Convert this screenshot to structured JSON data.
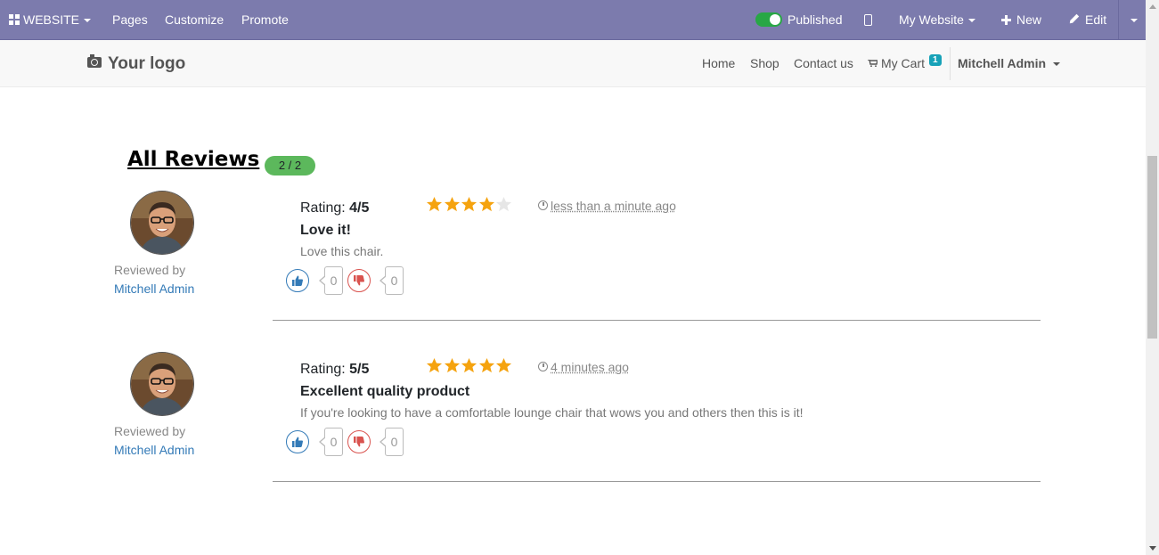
{
  "admin_bar": {
    "website_label": "WEBSITE",
    "pages_label": "Pages",
    "customize_label": "Customize",
    "promote_label": "Promote",
    "published_label": "Published",
    "published_on": true,
    "my_website_label": "My Website",
    "new_label": "New",
    "edit_label": "Edit",
    "bar_color": "#7c7bad"
  },
  "site_nav": {
    "logo_text": "Your logo",
    "links": [
      "Home",
      "Shop",
      "Contact us"
    ],
    "cart_label": "My Cart",
    "cart_count": "1",
    "user_name": "Mitchell Admin"
  },
  "reviews": {
    "title": "All Reviews",
    "count_badge": "2 / 2",
    "reviewed_by_label": "Reviewed by",
    "items": [
      {
        "rating_label": "Rating:",
        "rating_value": "4/5",
        "stars": 4,
        "time": "less than a minute ago",
        "title": "Love it!",
        "body": "Love this chair.",
        "reviewer": "Mitchell Admin",
        "likes": "0",
        "dislikes": "0"
      },
      {
        "rating_label": "Rating:",
        "rating_value": "5/5",
        "stars": 5,
        "time": "4 minutes ago",
        "title": "Excellent quality product",
        "body": "If you're looking to have a comfortable lounge chair that wows you and others then this is it!",
        "reviewer": "Mitchell Admin",
        "likes": "0",
        "dislikes": "0"
      }
    ]
  },
  "colors": {
    "star_filled": "#f5a30f",
    "star_empty": "#e6e6e6",
    "badge": "#5cb85c",
    "link": "#337ab7"
  }
}
